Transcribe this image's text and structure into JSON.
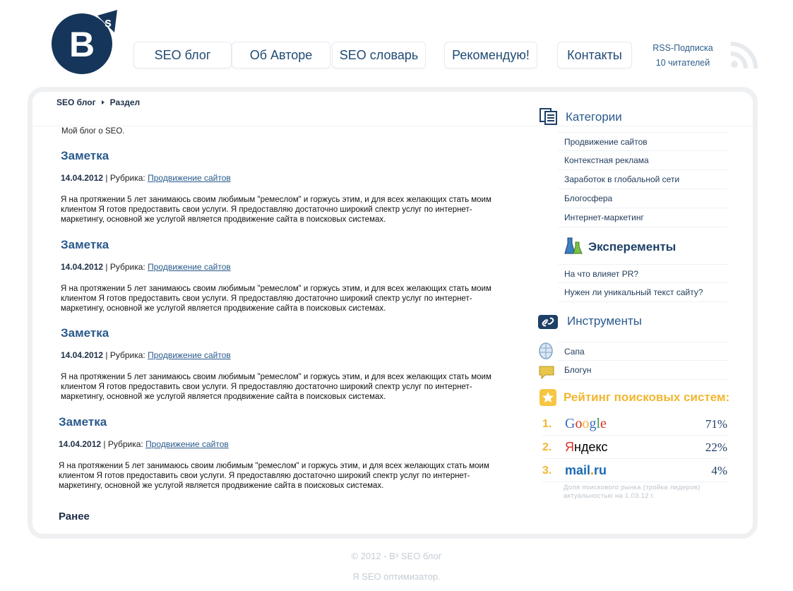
{
  "header": {
    "logo_letter": "B",
    "logo_sup": "s",
    "nav": [
      {
        "label": "SEO блог"
      },
      {
        "label": "Об Авторе"
      },
      {
        "label": "SEO словарь"
      },
      {
        "label": "Рекомендую!"
      },
      {
        "label": "Контакты"
      }
    ],
    "rss_label": "RSS-Подписка",
    "rss_count": "10 читателей"
  },
  "breadcrumb": {
    "items": [
      "SEO блог",
      "Раздел"
    ]
  },
  "intro": "Мой блог о SEO.",
  "posts": [
    {
      "title": "Заметка",
      "date": "14.04.2012",
      "rubric_label": "| Рубрика:",
      "rubric": "Продвижение сайтов",
      "body": "Я на протяжении 5 лет занимаюсь своим любимым \"ремеслом\" и горжусь этим, и для всех желающих стать моим клиентом Я готов предоставить свои услуги. Я предоставляю достаточно широкий спектр услуг по интернет-маркетингу, основной же услугой является продвижение сайта в поисковых системах."
    },
    {
      "title": "Заметка",
      "date": "14.04.2012",
      "rubric_label": "| Рубрика:",
      "rubric": "Продвижение сайтов",
      "body": "Я на протяжении 5 лет занимаюсь своим любимым \"ремеслом\" и горжусь этим, и для всех желающих стать моим клиентом Я готов предоставить свои услуги. Я предоставляю достаточно широкий спектр услуг по интернет-маркетингу, основной же услугой является продвижение сайта в поисковых системах."
    },
    {
      "title": "Заметка",
      "date": "14.04.2012",
      "rubric_label": "| Рубрика:",
      "rubric": "Продвижение сайтов",
      "body": "Я на протяжении 5 лет занимаюсь своим любимым \"ремеслом\" и горжусь этим, и для всех желающих стать моим клиентом Я готов предоставить свои услуги. Я предоставляю достаточно широкий спектр услуг по интернет-маркетингу, основной же услугой является продвижение сайта в поисковых системах."
    },
    {
      "title": "Заметка",
      "date": "14.04.2012",
      "rubric_label": "| Рубрика:",
      "rubric": "Продвижение сайтов",
      "body": "Я на протяжении 5 лет занимаюсь своим любимым \"ремеслом\" и горжусь этим, и для всех желающих стать моим клиентом Я готов предоставить свои услуги. Я предоставляю достаточно широкий спектр услуг по интернет-маркетингу, основной же услугой является продвижение сайта в поисковых системах."
    }
  ],
  "earlier": "Ранее",
  "sidebar": {
    "categories": {
      "title": "Категории",
      "icon": "categories-icon",
      "items": [
        "Продвижение сайтов",
        "Контекстная реклама",
        "Заработок в глобальной сети",
        "Блогосфера",
        "Интернет-маркетинг"
      ]
    },
    "experiments": {
      "title": "Эксперементы",
      "icon": "flask-icon",
      "items": [
        "На что влияет PR?",
        "Нужен ли уникальный текст сайту?"
      ]
    },
    "tools": {
      "title": "Инструменты",
      "icon": "link-icon",
      "items": [
        {
          "label": "Сапа",
          "icon": "sapa-icon"
        },
        {
          "label": "Блогун",
          "icon": "blogun-icon"
        }
      ]
    },
    "rating": {
      "title": "Рейтинг поисковых систем:",
      "icon": "star-icon",
      "rows": [
        {
          "num": "1.",
          "name": "Google",
          "pct": "71%"
        },
        {
          "num": "2.",
          "name": "Яндекс",
          "pct": "22%"
        },
        {
          "num": "3.",
          "name": "mail.ru",
          "pct": "4%"
        }
      ],
      "note_line1": "Доля поискового рынка (тройка лидеров)",
      "note_line2": "актуальностью на 1.03.12 г."
    }
  },
  "footer": {
    "copyright": "© 2012 - Bˢ SEO блог",
    "tagline": "Я SEO оптимизатор."
  },
  "colors": {
    "brand": "#16355a",
    "link": "#2a5a8c",
    "accent": "#f2b630"
  }
}
